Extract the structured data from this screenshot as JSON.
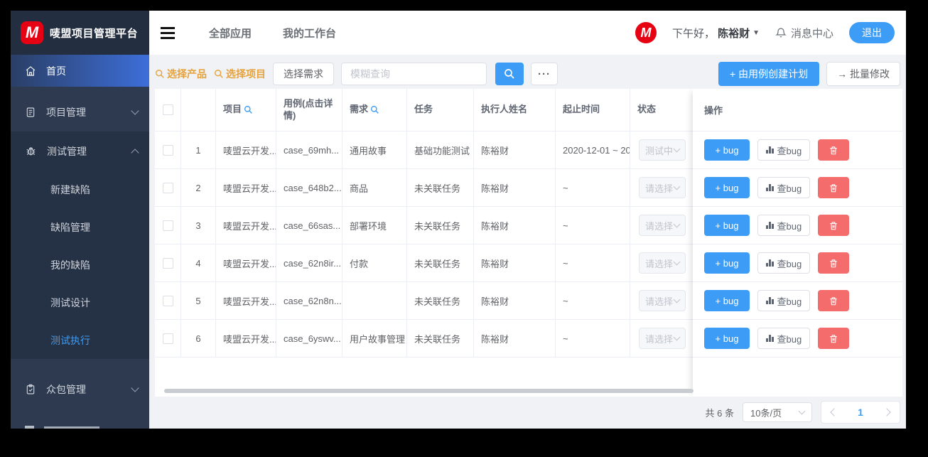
{
  "app": {
    "brand": "唛盟项目管理平台",
    "logo_letter": "M",
    "accent_color": "#3d9df6",
    "danger_color": "#f56c6c",
    "warning_color": "#e6a23c",
    "brand_red": "#e60113"
  },
  "topnav": {
    "items": [
      {
        "label": "全部应用"
      },
      {
        "label": "我的工作台"
      }
    ],
    "greeting": "下午好，",
    "username": "陈裕财",
    "caret": "▼",
    "message_center": "消息中心",
    "logout": "退出",
    "avatar_letter": "M"
  },
  "sidebar": {
    "items": [
      {
        "label": "首页",
        "icon": "home-icon",
        "active": true,
        "type": "single"
      },
      {
        "label": "项目管理",
        "icon": "document-icon",
        "type": "group",
        "expanded": false
      },
      {
        "label": "测试管理",
        "icon": "bug-icon",
        "type": "group",
        "expanded": true,
        "children": [
          {
            "label": "新建缺陷"
          },
          {
            "label": "缺陷管理"
          },
          {
            "label": "我的缺陷"
          },
          {
            "label": "测试设计"
          },
          {
            "label": "测试执行",
            "active": true
          }
        ]
      },
      {
        "label": "众包管理",
        "icon": "clipboard-icon",
        "type": "group",
        "expanded": false
      }
    ]
  },
  "toolbar": {
    "select_product": "选择产品",
    "select_project": "选择项目",
    "select_requirement": "选择需求",
    "search_placeholder": "模糊查询",
    "more_label": "···",
    "create_plan_label": "+ 由用例创建计划",
    "batch_edit_label": "→ 批量修改"
  },
  "table": {
    "headers": [
      {
        "label": "",
        "type": "checkbox"
      },
      {
        "label": "",
        "type": "index"
      },
      {
        "label": "项目",
        "search": true
      },
      {
        "label": "用例(点击详情)"
      },
      {
        "label": "需求",
        "search": true
      },
      {
        "label": "任务"
      },
      {
        "label": "执行人姓名"
      },
      {
        "label": "起止时间"
      },
      {
        "label": "状态"
      }
    ],
    "rows": [
      {
        "index": "1",
        "project": "唛盟云开发...",
        "case": "case_69mh...",
        "requirement": "通用故事",
        "task": "基础功能测试",
        "executor": "陈裕财",
        "dates": "2020-12-01 ~ 20",
        "status": "测试中"
      },
      {
        "index": "2",
        "project": "唛盟云开发...",
        "case": "case_648b2...",
        "requirement": "商品",
        "task": "未关联任务",
        "executor": "陈裕财",
        "dates": "~",
        "status": "请选择"
      },
      {
        "index": "3",
        "project": "唛盟云开发...",
        "case": "case_66sas...",
        "requirement": "部署环境",
        "task": "未关联任务",
        "executor": "陈裕财",
        "dates": "~",
        "status": "请选择"
      },
      {
        "index": "4",
        "project": "唛盟云开发...",
        "case": "case_62n8ir...",
        "requirement": "付款",
        "task": "未关联任务",
        "executor": "陈裕财",
        "dates": "~",
        "status": "请选择"
      },
      {
        "index": "5",
        "project": "唛盟云开发...",
        "case": "case_62n8n...",
        "requirement": "",
        "task": "未关联任务",
        "executor": "陈裕财",
        "dates": "~",
        "status": "请选择"
      },
      {
        "index": "6",
        "project": "唛盟云开发...",
        "case": "case_6yswv...",
        "requirement": "用户故事管理",
        "task": "未关联任务",
        "executor": "陈裕财",
        "dates": "~",
        "status": "请选择"
      }
    ],
    "ops": {
      "header": "操作",
      "add_bug_label": "+ bug",
      "view_bug_label": "查bug",
      "delete_icon": "trash-icon"
    }
  },
  "pagination": {
    "total": "共 6 条",
    "page_size": "10条/页",
    "current_page": "1"
  }
}
